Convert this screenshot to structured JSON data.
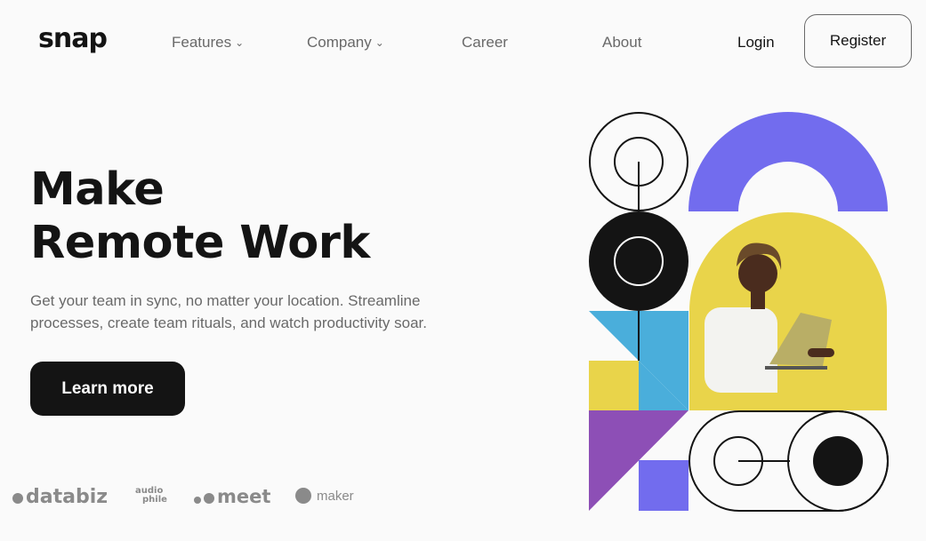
{
  "brand": {
    "logo": "snap"
  },
  "nav": {
    "items": [
      {
        "label": "Features",
        "has_dropdown": true
      },
      {
        "label": "Company",
        "has_dropdown": true
      },
      {
        "label": "Career",
        "has_dropdown": false
      },
      {
        "label": "About",
        "has_dropdown": false
      }
    ],
    "login": "Login",
    "register": "Register"
  },
  "hero": {
    "title_line1": "Make",
    "title_line2": "Remote Work",
    "description": "Get your team in sync, no matter your location. Streamline processes, create team rituals, and watch productivity soar.",
    "cta": "Learn more"
  },
  "clients": {
    "databiz": "databiz",
    "audiophile_top": "audio",
    "audiophile_bottom": "phile",
    "meet": "meet",
    "maker": "maker"
  },
  "colors": {
    "purple": "#726cee",
    "yellow": "#e9d44a",
    "blue": "#4aaedb",
    "violet": "#8d4fb6",
    "dark": "#141414",
    "gray": "#696969"
  }
}
